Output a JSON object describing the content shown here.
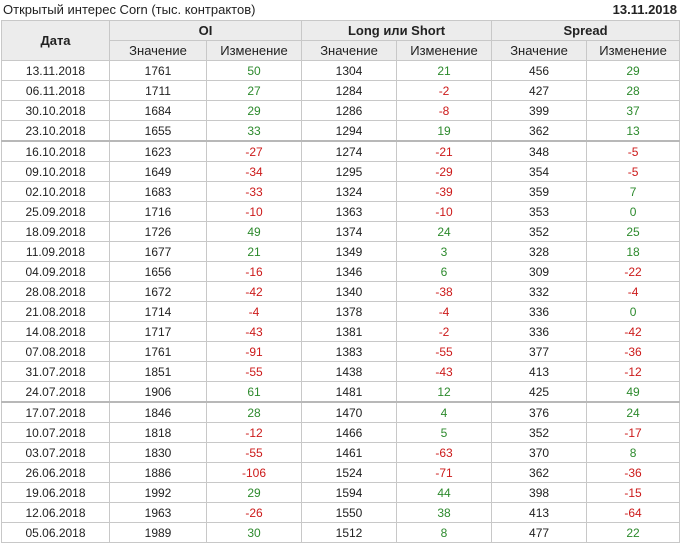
{
  "header": {
    "title": "Открытый интерес Corn (тыс. контрактов)",
    "date": "13.11.2018"
  },
  "table": {
    "col_date": "Дата",
    "group_oi": "OI",
    "group_ls": "Long или Short",
    "group_spread": "Spread",
    "sub_value": "Значение",
    "sub_change": "Изменение",
    "rows": [
      [
        "13.11.2018",
        "1761",
        "50",
        "1304",
        "21",
        "456",
        "29"
      ],
      [
        "06.11.2018",
        "1711",
        "27",
        "1284",
        "-2",
        "427",
        "28"
      ],
      [
        "30.10.2018",
        "1684",
        "29",
        "1286",
        "-8",
        "399",
        "37"
      ],
      [
        "23.10.2018",
        "1655",
        "33",
        "1294",
        "19",
        "362",
        "13"
      ],
      [
        "16.10.2018",
        "1623",
        "-27",
        "1274",
        "-21",
        "348",
        "-5"
      ],
      [
        "09.10.2018",
        "1649",
        "-34",
        "1295",
        "-29",
        "354",
        "-5"
      ],
      [
        "02.10.2018",
        "1683",
        "-33",
        "1324",
        "-39",
        "359",
        "7"
      ],
      [
        "25.09.2018",
        "1716",
        "-10",
        "1363",
        "-10",
        "353",
        "0"
      ],
      [
        "18.09.2018",
        "1726",
        "49",
        "1374",
        "24",
        "352",
        "25"
      ],
      [
        "11.09.2018",
        "1677",
        "21",
        "1349",
        "3",
        "328",
        "18"
      ],
      [
        "04.09.2018",
        "1656",
        "-16",
        "1346",
        "6",
        "309",
        "-22"
      ],
      [
        "28.08.2018",
        "1672",
        "-42",
        "1340",
        "-38",
        "332",
        "-4"
      ],
      [
        "21.08.2018",
        "1714",
        "-4",
        "1378",
        "-4",
        "336",
        "0"
      ],
      [
        "14.08.2018",
        "1717",
        "-43",
        "1381",
        "-2",
        "336",
        "-42"
      ],
      [
        "07.08.2018",
        "1761",
        "-91",
        "1383",
        "-55",
        "377",
        "-36"
      ],
      [
        "31.07.2018",
        "1851",
        "-55",
        "1438",
        "-43",
        "413",
        "-12"
      ],
      [
        "24.07.2018",
        "1906",
        "61",
        "1481",
        "12",
        "425",
        "49"
      ],
      [
        "17.07.2018",
        "1846",
        "28",
        "1470",
        "4",
        "376",
        "24"
      ],
      [
        "10.07.2018",
        "1818",
        "-12",
        "1466",
        "5",
        "352",
        "-17"
      ],
      [
        "03.07.2018",
        "1830",
        "-55",
        "1461",
        "-63",
        "370",
        "8"
      ],
      [
        "26.06.2018",
        "1886",
        "-106",
        "1524",
        "-71",
        "362",
        "-36"
      ],
      [
        "19.06.2018",
        "1992",
        "29",
        "1594",
        "44",
        "398",
        "-15"
      ],
      [
        "12.06.2018",
        "1963",
        "-26",
        "1550",
        "38",
        "413",
        "-64"
      ],
      [
        "05.06.2018",
        "1989",
        "30",
        "1512",
        "8",
        "477",
        "22"
      ]
    ],
    "separator_rows": [
      4,
      17
    ],
    "colors": {
      "positive": "#2d8a2d",
      "negative": "#cc1a1a"
    }
  }
}
